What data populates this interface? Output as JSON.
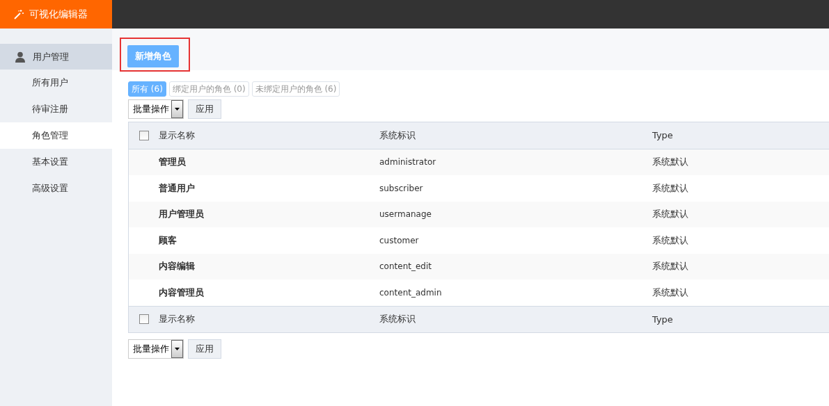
{
  "app": {
    "title": "可视化编辑器"
  },
  "sidebar": {
    "group": "用户管理",
    "items": [
      {
        "label": "所有用户",
        "selected": false
      },
      {
        "label": "待审注册",
        "selected": false
      },
      {
        "label": "角色管理",
        "selected": true
      },
      {
        "label": "基本设置",
        "selected": false
      },
      {
        "label": "高级设置",
        "selected": false
      }
    ]
  },
  "add_button": "新增角色",
  "filters": [
    {
      "label": "所有 (6)",
      "selected": true
    },
    {
      "label": "绑定用户的角色 (0)",
      "selected": false
    },
    {
      "label": "未绑定用户的角色 (6)",
      "selected": false
    }
  ],
  "bulk_top": {
    "select": "批量操作",
    "apply": "应用"
  },
  "table": {
    "columns": [
      "显示名称",
      "系统标识",
      "Type"
    ],
    "header_checked": false,
    "rows": [
      {
        "name": "管理员",
        "slug": "administrator",
        "type": "系统默认"
      },
      {
        "name": "普通用户",
        "slug": "subscriber",
        "type": "系统默认"
      },
      {
        "name": "用户管理员",
        "slug": "usermanage",
        "type": "系统默认"
      },
      {
        "name": "顾客",
        "slug": "customer",
        "type": "系统默认"
      },
      {
        "name": "内容编辑",
        "slug": "content_edit",
        "type": "系统默认"
      },
      {
        "name": "内容管理员",
        "slug": "content_admin",
        "type": "系统默认"
      }
    ],
    "footer_columns": [
      "显示名称",
      "系统标识",
      "Type"
    ],
    "footer_checked": false
  },
  "bulk_bottom": {
    "select": "批量操作",
    "apply": "应用"
  }
}
